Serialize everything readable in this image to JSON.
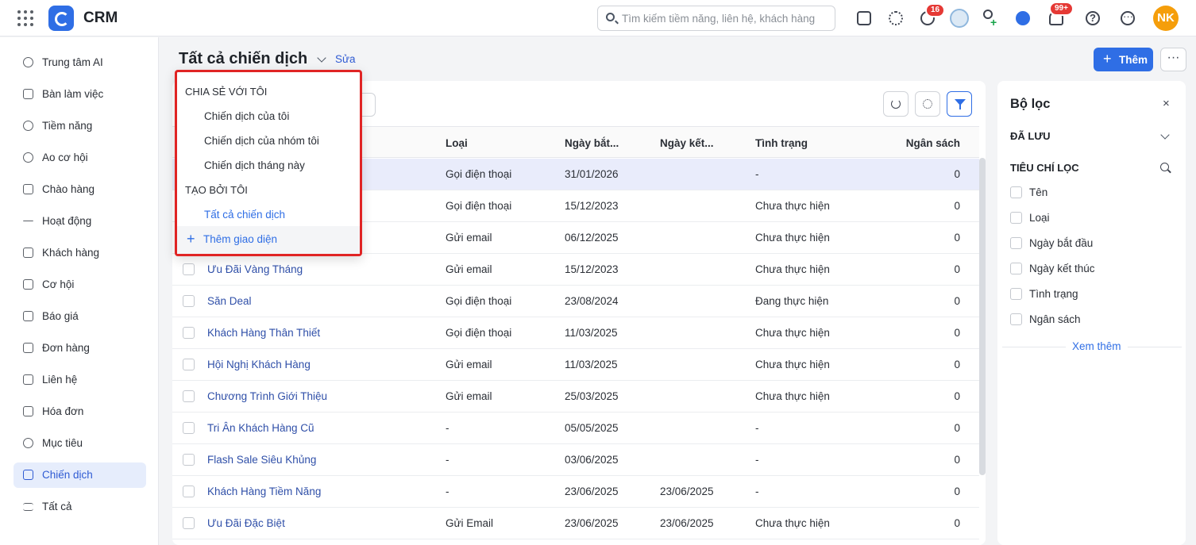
{
  "app": {
    "name": "CRM"
  },
  "search": {
    "placeholder": "Tìm kiếm tiềm năng, liên hệ, khách hàng"
  },
  "header": {
    "timer_badge": "16",
    "notif_badge": "99+",
    "user_initials": "NK"
  },
  "sidebar": {
    "items": [
      {
        "label": "Trung tâm AI",
        "icon": "sparkle-icon"
      },
      {
        "label": "Bàn làm việc",
        "icon": "home-icon"
      },
      {
        "label": "Tiềm năng",
        "icon": "lead-icon"
      },
      {
        "label": "Ao cơ hội",
        "icon": "pool-icon"
      },
      {
        "label": "Chào hàng",
        "icon": "magnet-icon"
      },
      {
        "label": "Hoạt động",
        "icon": "activity-icon"
      },
      {
        "label": "Khách hàng",
        "icon": "building-icon"
      },
      {
        "label": "Cơ hội",
        "icon": "opportunity-icon"
      },
      {
        "label": "Báo giá",
        "icon": "quote-icon"
      },
      {
        "label": "Đơn hàng",
        "icon": "cart-icon"
      },
      {
        "label": "Liên hệ",
        "icon": "contact-icon"
      },
      {
        "label": "Hóa đơn",
        "icon": "invoice-icon"
      },
      {
        "label": "Mục tiêu",
        "icon": "target-icon"
      },
      {
        "label": "Chiến dịch",
        "icon": "megaphone-icon",
        "active": true
      },
      {
        "label": "Tất cả",
        "icon": "list-icon"
      }
    ]
  },
  "page": {
    "title": "Tất cả chiến dịch",
    "edit_label": "Sửa",
    "add_label": "Thêm",
    "more_label": "···"
  },
  "dropdown": {
    "shared_heading": "CHIA SẺ VỚI TÔI",
    "shared_items": [
      "Chiến dịch của tôi",
      "Chiến dịch của nhóm tôi",
      "Chiến dịch tháng này"
    ],
    "created_heading": "TẠO BỞI TÔI",
    "created_items": [
      "Tất cả chiến dịch"
    ],
    "add_view_label": "Thêm giao diện"
  },
  "table": {
    "columns": {
      "type": "Loại",
      "start": "Ngày bắt...",
      "end": "Ngày kết...",
      "status": "Tình trạng",
      "budget": "Ngân sách"
    },
    "rows": [
      {
        "name": "",
        "type": "Gọi điện thoại",
        "start": "31/01/2026",
        "end": "",
        "status": "-",
        "budget": "0",
        "highlighted": true
      },
      {
        "name": "",
        "type": "Gọi điện thoại",
        "start": "15/12/2023",
        "end": "",
        "status": "Chưa thực hiện",
        "budget": "0"
      },
      {
        "name": "",
        "type": "Gửi email",
        "start": "06/12/2025",
        "end": "",
        "status": "Chưa thực hiện",
        "budget": "0"
      },
      {
        "name": "Ưu Đãi Vàng Tháng",
        "type": "Gửi email",
        "start": "15/12/2023",
        "end": "",
        "status": "Chưa thực hiện",
        "budget": "0"
      },
      {
        "name": "Săn Deal",
        "type": "Gọi điện thoại",
        "start": "23/08/2024",
        "end": "",
        "status": "Đang thực hiện",
        "budget": "0"
      },
      {
        "name": "Khách Hàng Thân Thiết",
        "type": "Gọi điện thoại",
        "start": "11/03/2025",
        "end": "",
        "status": "Chưa thực hiện",
        "budget": "0"
      },
      {
        "name": "Hội Nghị Khách Hàng",
        "type": "Gửi email",
        "start": "11/03/2025",
        "end": "",
        "status": "Chưa thực hiện",
        "budget": "0"
      },
      {
        "name": "Chương Trình Giới Thiệu",
        "type": "Gửi email",
        "start": "25/03/2025",
        "end": "",
        "status": "Chưa thực hiện",
        "budget": "0"
      },
      {
        "name": "Tri Ân Khách Hàng Cũ",
        "type": "-",
        "start": "05/05/2025",
        "end": "",
        "status": "-",
        "budget": "0"
      },
      {
        "name": "Flash Sale Siêu Khủng",
        "type": "-",
        "start": "03/06/2025",
        "end": "",
        "status": "-",
        "budget": "0"
      },
      {
        "name": "Khách Hàng Tiềm Năng",
        "type": "-",
        "start": "23/06/2025",
        "end": "23/06/2025",
        "status": "-",
        "budget": "0"
      },
      {
        "name": "Ưu Đãi Đặc Biệt",
        "type": "Gửi Email",
        "start": "23/06/2025",
        "end": "23/06/2025",
        "status": "Chưa thực hiện",
        "budget": "0"
      }
    ]
  },
  "filter": {
    "title": "Bộ lọc",
    "close": "×",
    "saved_heading": "ĐÃ LƯU",
    "criteria_heading": "TIÊU CHÍ LỌC",
    "options": [
      "Tên",
      "Loại",
      "Ngày bắt đầu",
      "Ngày kết thúc",
      "Tình trạng",
      "Ngân sách"
    ],
    "more_label": "Xem thêm"
  }
}
